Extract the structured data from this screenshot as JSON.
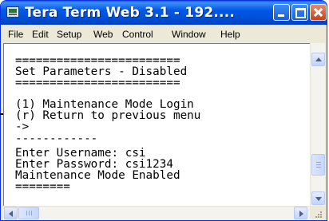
{
  "window": {
    "title": "Tera Term Web 3.1 - 192...."
  },
  "titlebar_buttons": [
    "minimize",
    "maximize",
    "close"
  ],
  "menu": [
    {
      "label": "File"
    },
    {
      "label": "Edit"
    },
    {
      "label": "Setup"
    },
    {
      "label": "Web"
    },
    {
      "label": "Control"
    },
    {
      "label": "Window"
    },
    {
      "label": "Help"
    }
  ],
  "terminal": {
    "lines": [
      "========================",
      "Set Parameters - Disabled",
      "========================",
      "(1) Maintenance Mode Login",
      "(r) Return to previous menu",
      "->",
      "------------",
      "Enter Username: csi",
      "Enter Password: csi1234",
      "Maintenance Mode Enabled",
      "========"
    ]
  },
  "icons": {
    "app": "terminal-app-icon",
    "scroll_up": "arrow-up-icon",
    "scroll_down": "arrow-down-icon",
    "scroll_left": "arrow-left-icon",
    "scroll_right": "arrow-right-icon",
    "resize_grip": "resize-grip-icon"
  },
  "colors": {
    "titlebar": "#0058e6",
    "close_button": "#c4431e",
    "menubar": "#ece9d8",
    "terminal_bg": "#ffffff",
    "terminal_text": "#000000"
  }
}
